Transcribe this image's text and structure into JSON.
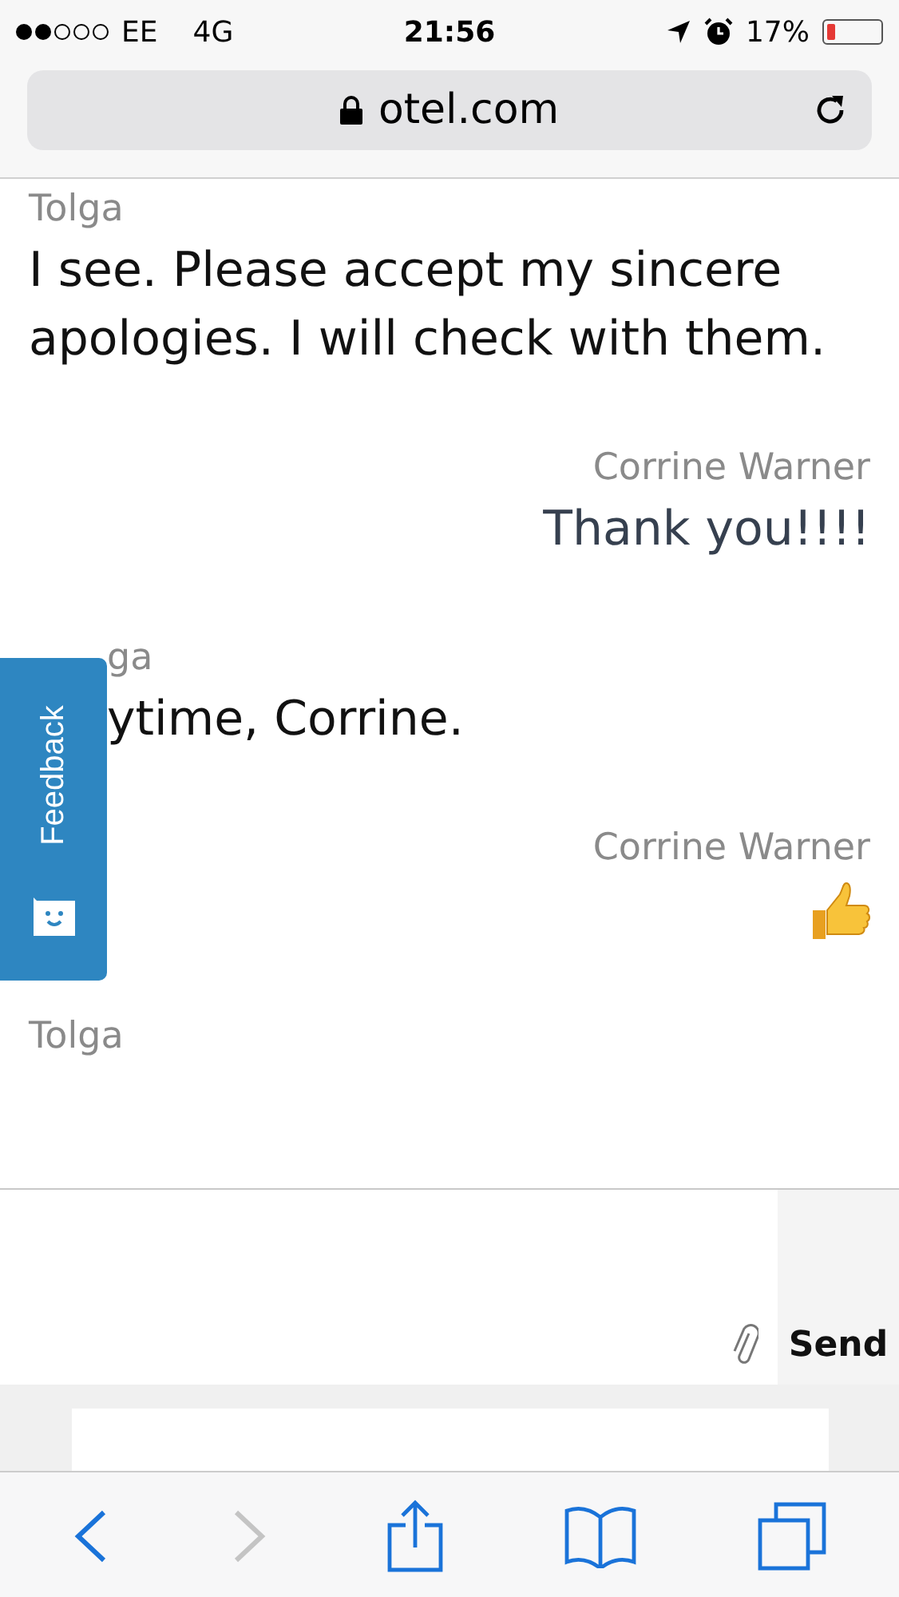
{
  "status_bar": {
    "carrier": "EE",
    "network": "4G",
    "time": "21:56",
    "battery": "17%"
  },
  "address_bar": {
    "url": "otel.com"
  },
  "messages": [
    {
      "outgoing": false,
      "partial": false,
      "sender": "Tolga",
      "text": "I see. Please accept my sincere apologies. I will check with them.",
      "kind": "text"
    },
    {
      "outgoing": true,
      "partial": false,
      "sender": "Corrine Warner",
      "text": "Thank you!!!!",
      "kind": "text"
    },
    {
      "outgoing": false,
      "partial": true,
      "sender": "ga",
      "text": "ytime, Corrine.",
      "kind": "text"
    },
    {
      "outgoing": true,
      "partial": false,
      "sender": "Corrine Warner",
      "kind": "thumbs"
    },
    {
      "outgoing": false,
      "partial": false,
      "sender": "Tolga",
      "kind": "none"
    }
  ],
  "feedback_tab": {
    "label": "Feedback"
  },
  "composer": {
    "send": "Send"
  },
  "toolbar": {
    "back_disabled": false,
    "forward_disabled": true
  }
}
